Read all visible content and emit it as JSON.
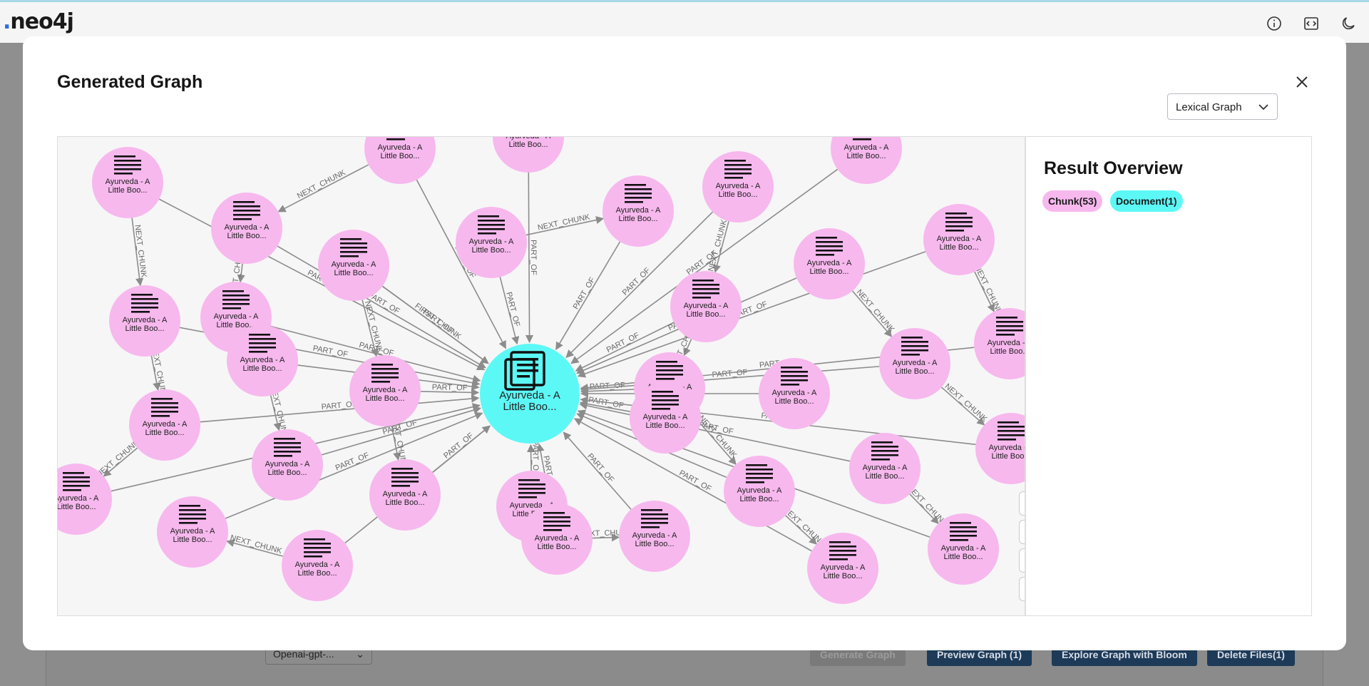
{
  "app": {
    "logo_text": "neo4j"
  },
  "topbar_icons": [
    "info-icon",
    "code-icon",
    "moon-icon"
  ],
  "background": {
    "model_select": "Openai-gpt-...",
    "buttons": [
      "Generate Graph",
      "Preview Graph (1)",
      "Explore Graph with Bloom",
      "Delete Files(1)"
    ]
  },
  "modal": {
    "title": "Generated Graph",
    "view_select": "Lexical Graph",
    "close_icon": "close-icon"
  },
  "overview": {
    "title": "Result Overview",
    "chips": [
      {
        "label": "Chunk(53)",
        "color": "#f7b8ee"
      },
      {
        "label": "Document(1)",
        "color": "#5cf8f6"
      }
    ]
  },
  "graph": {
    "document_label": "Ayurveda - A\nLittle Boo...",
    "chunk_label_line1": "Ayurveda - A",
    "chunk_label_line2": "Little Boo...",
    "relationship_labels": [
      "PART_OF",
      "NEXT_CHUNK",
      "FIRST_CHUNK"
    ],
    "colors": {
      "chunk": "#f7b8ee",
      "document": "#5cf8f6",
      "edge": "#8c8c8c"
    }
  },
  "controls": [
    "refresh-icon",
    "zoom-in-icon",
    "zoom-out-icon",
    "fit-icon"
  ]
}
